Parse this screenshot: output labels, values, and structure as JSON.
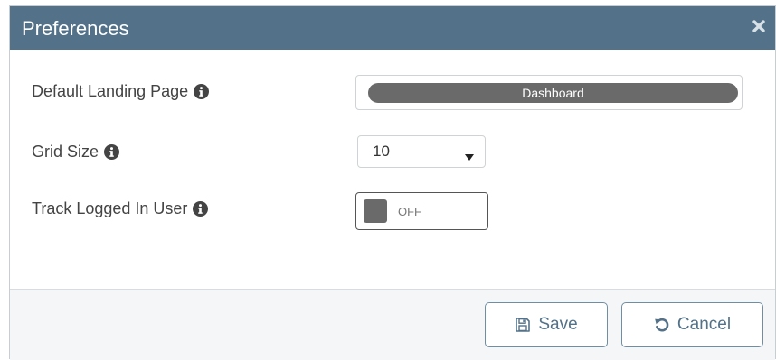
{
  "dialog": {
    "title": "Preferences",
    "close_icon": "close-icon",
    "colors": {
      "titlebar": "#537289",
      "toggle_off": "#6a6a6a",
      "button_text": "#537289"
    }
  },
  "fields": {
    "landing": {
      "label": "Default Landing Page",
      "value": "Dashboard",
      "icon": "info-icon"
    },
    "grid_size": {
      "label": "Grid Size",
      "value": "10",
      "icon": "info-icon"
    },
    "track_user": {
      "label": "Track Logged In User",
      "state": "OFF",
      "icon": "info-icon"
    }
  },
  "footer": {
    "save_label": "Save",
    "save_icon": "floppy-disk-icon",
    "cancel_label": "Cancel",
    "cancel_icon": "undo-icon"
  }
}
